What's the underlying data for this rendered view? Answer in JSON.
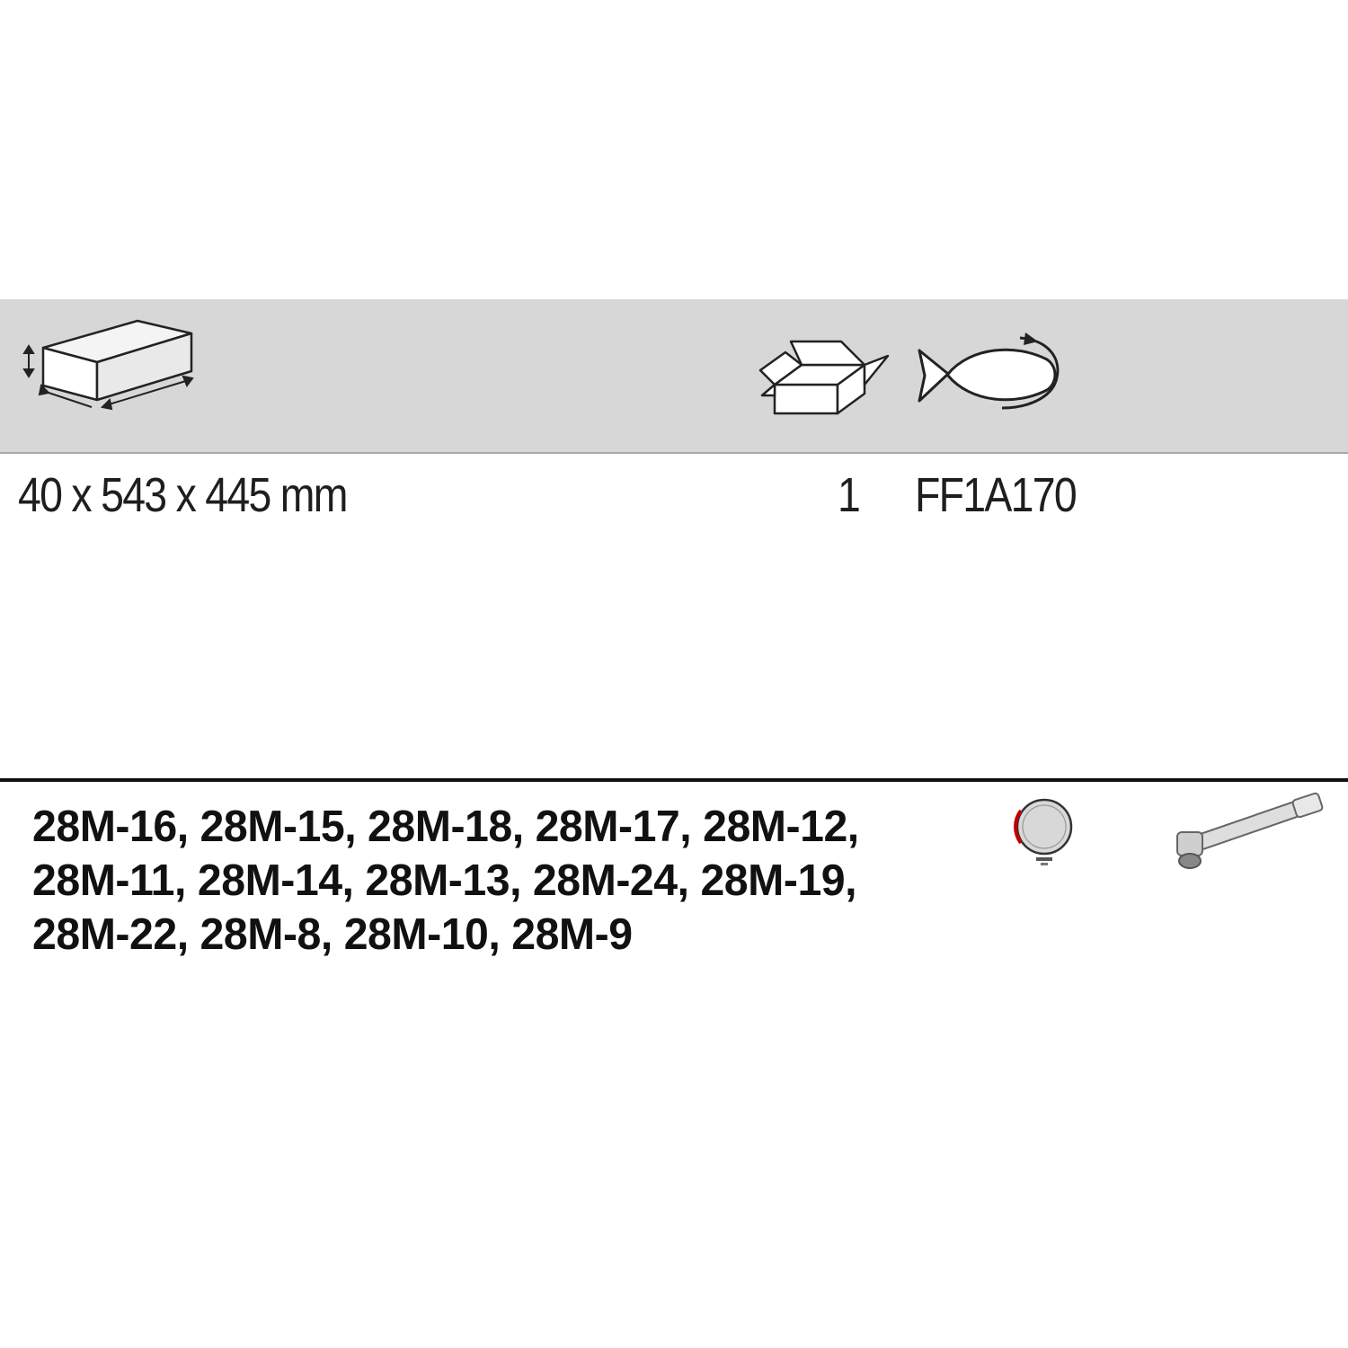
{
  "header": {
    "dimensions_icon": "box-dimensions-icon",
    "quantity_icon": "open-box-icon",
    "reference_icon": "foam-tray-fish-icon"
  },
  "spec": {
    "dimensions": "40 x 543 x 445 mm",
    "quantity": "1",
    "code": "FF1A170"
  },
  "contents": {
    "references": "28M-16, 28M-15, 28M-18, 28M-17, 28M-12, 28M-11, 28M-14, 28M-13, 28M-24, 28M-19, 28M-22, 28M-8, 28M-10, 28M-9",
    "icons": [
      "gauge-dial-icon",
      "offset-socket-wrench-icon"
    ]
  }
}
